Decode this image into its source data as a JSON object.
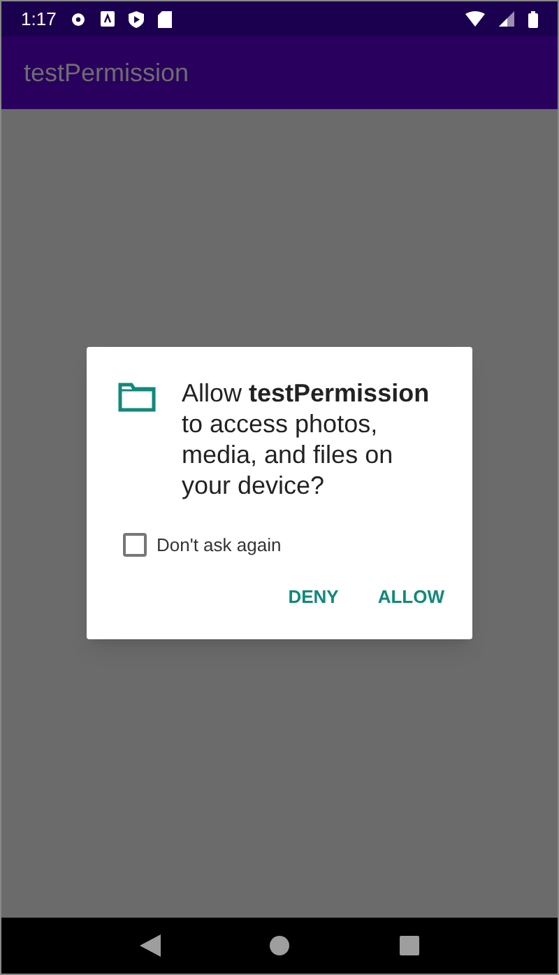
{
  "status_bar": {
    "time": "1:17"
  },
  "app_bar": {
    "title": "testPermission"
  },
  "dialog": {
    "message": "Allow **testPermission** to access photos, media, and files on your device?",
    "checkbox": {
      "label": "Don't ask again",
      "checked": false
    },
    "buttons": [
      "DENY",
      "ALLOW"
    ]
  }
}
